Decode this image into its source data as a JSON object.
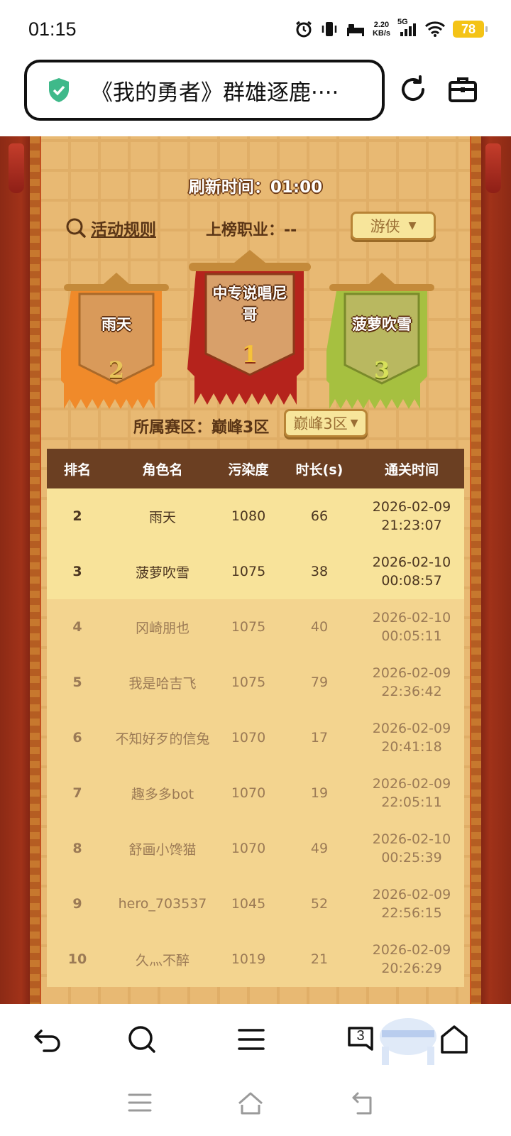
{
  "status_bar": {
    "time": "01:15",
    "net_speed_value": "2.20",
    "net_speed_unit": "KB/s",
    "network": "5G",
    "battery": "78"
  },
  "browser": {
    "url_title": "《我的勇者》群雄逐鹿····",
    "icons": [
      "shield-check-icon",
      "refresh-icon",
      "toolbox-icon"
    ]
  },
  "game": {
    "refresh_time": "刷新时间：01:00",
    "rules_label": "活动规则",
    "job_label": "上榜职业：--",
    "job_select": "游侠",
    "zone_label": "所属赛区：巅峰3区",
    "zone_select": "巅峰3区",
    "podium": [
      {
        "rank": "2",
        "name": "雨天",
        "color": "#f08a2a"
      },
      {
        "rank": "1",
        "name": "中专说唱尼哥",
        "color": "#b5231c"
      },
      {
        "rank": "3",
        "name": "菠萝吹雪",
        "color": "#a6c040"
      }
    ],
    "table": {
      "headers": [
        "排名",
        "角色名",
        "污染度",
        "时长(s)",
        "通关时间"
      ],
      "rows": [
        {
          "rank": "2",
          "name": "雨天",
          "pollution": "1080",
          "duration": "66",
          "date": "2026-02-09",
          "time": "21:23:07"
        },
        {
          "rank": "3",
          "name": "菠萝吹雪",
          "pollution": "1075",
          "duration": "38",
          "date": "2026-02-10",
          "time": "00:08:57"
        },
        {
          "rank": "4",
          "name": "冈崎朋也",
          "pollution": "1075",
          "duration": "40",
          "date": "2026-02-10",
          "time": "00:05:11"
        },
        {
          "rank": "5",
          "name": "我是哈吉飞",
          "pollution": "1075",
          "duration": "79",
          "date": "2026-02-09",
          "time": "22:36:42"
        },
        {
          "rank": "6",
          "name": "不知好歹的信兔",
          "pollution": "1070",
          "duration": "17",
          "date": "2026-02-09",
          "time": "20:41:18"
        },
        {
          "rank": "7",
          "name": "趣多多bot",
          "pollution": "1070",
          "duration": "19",
          "date": "2026-02-09",
          "time": "22:05:11"
        },
        {
          "rank": "8",
          "name": "舒画小馋猫",
          "pollution": "1070",
          "duration": "49",
          "date": "2026-02-10",
          "time": "00:25:39"
        },
        {
          "rank": "9",
          "name": "hero_703537",
          "pollution": "1045",
          "duration": "52",
          "date": "2026-02-09",
          "time": "22:56:15"
        },
        {
          "rank": "10",
          "name": "久灬不醉",
          "pollution": "1019",
          "duration": "21",
          "date": "2026-02-09",
          "time": "20:26:29"
        }
      ]
    }
  },
  "bottom_nav": {
    "tab_count": "3",
    "icons": [
      "back-icon",
      "search-icon",
      "menu-icon",
      "tabs-icon",
      "home-icon"
    ]
  },
  "system_nav": {
    "icons": [
      "recents-icon",
      "home-icon",
      "back-icon"
    ]
  }
}
